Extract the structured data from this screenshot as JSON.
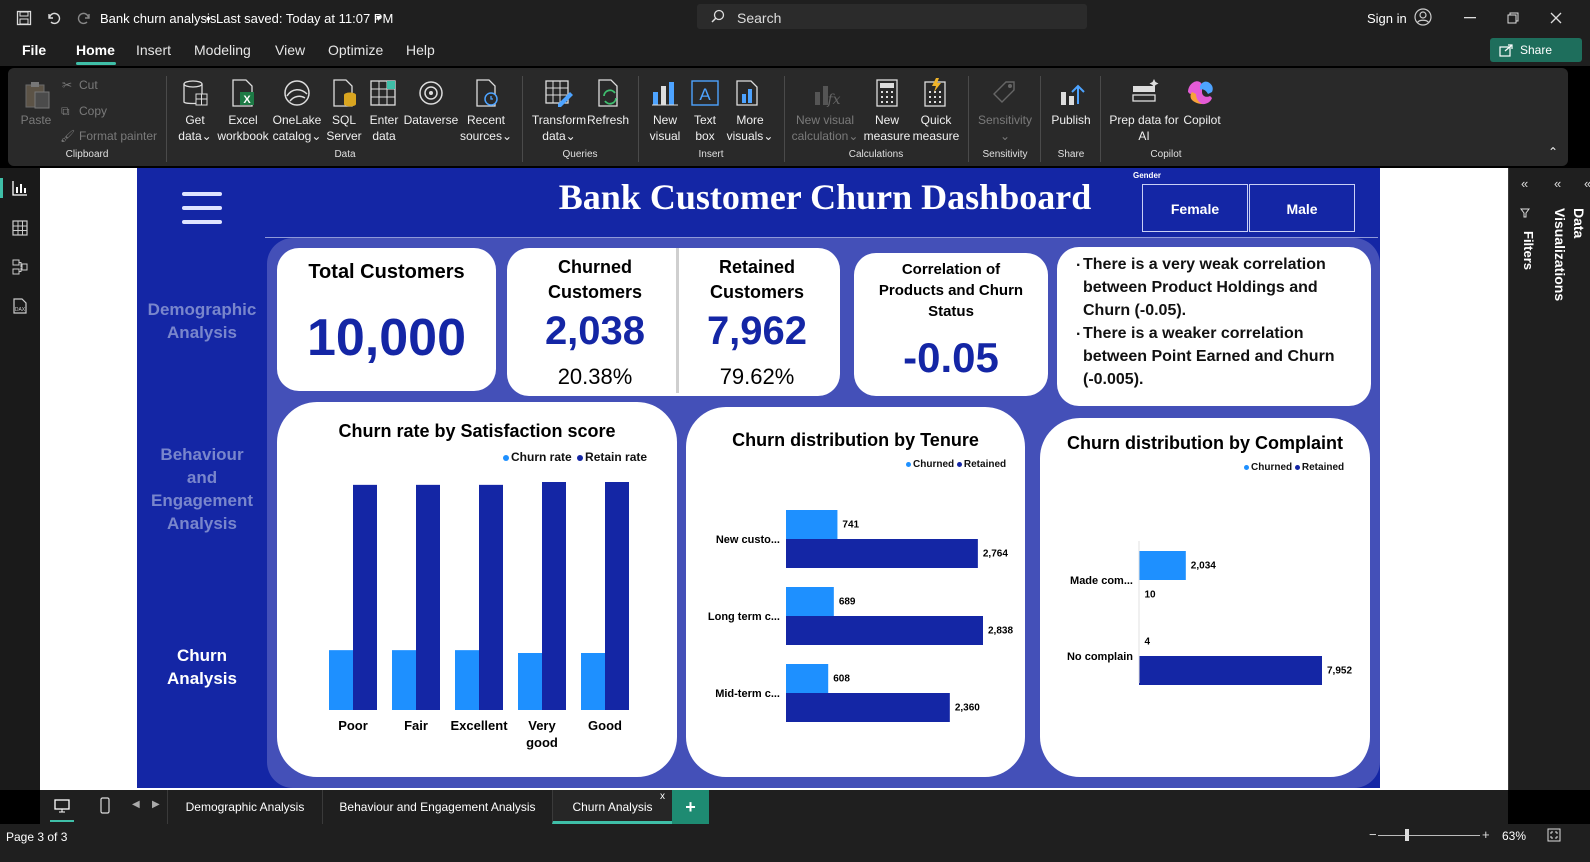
{
  "titlebar": {
    "doc_title": "Bank churn analysis",
    "saved": "Last saved: Today at 11:07 PM",
    "search_placeholder": "Search",
    "sign_in": "Sign in"
  },
  "menu": {
    "items": [
      "File",
      "Home",
      "Insert",
      "Modeling",
      "View",
      "Optimize",
      "Help"
    ],
    "active": "Home",
    "share": "Share"
  },
  "ribbon": {
    "clipboard": {
      "paste": "Paste",
      "cut": "Cut",
      "copy": "Copy",
      "format_painter": "Format painter",
      "group": "Clipboard"
    },
    "data": {
      "get_data": [
        "Get",
        "data"
      ],
      "excel": [
        "Excel",
        "workbook"
      ],
      "onelake": [
        "OneLake",
        "catalog"
      ],
      "sql": [
        "SQL",
        "Server"
      ],
      "enter": [
        "Enter",
        "data"
      ],
      "dataverse": [
        "Dataverse",
        ""
      ],
      "recent": [
        "Recent",
        "sources"
      ],
      "group": "Data"
    },
    "queries": {
      "transform": [
        "Transform",
        "data"
      ],
      "refresh": [
        "Refresh",
        ""
      ],
      "group": "Queries"
    },
    "insert": {
      "new_visual": [
        "New",
        "visual"
      ],
      "text_box": [
        "Text",
        "box"
      ],
      "more_visuals": [
        "More",
        "visuals"
      ],
      "group": "Insert"
    },
    "calculations": {
      "new_visual_calc": [
        "New visual",
        "calculation"
      ],
      "new_measure": [
        "New",
        "measure"
      ],
      "quick_measure": [
        "Quick",
        "measure"
      ],
      "group": "Calculations"
    },
    "sensitivity": {
      "label": "Sensitivity",
      "group": "Sensitivity"
    },
    "share": {
      "publish": "Publish",
      "group": "Share"
    },
    "copilot": {
      "prep": [
        "Prep data for",
        "AI"
      ],
      "copilot": "Copilot",
      "group": "Copilot"
    }
  },
  "colors": {
    "report_bg": "#1426a5",
    "panel_bg": "#4450b8",
    "churned": "#1e90ff",
    "retained": "#1426a5",
    "accent": "#3fbfa8"
  },
  "dashboard": {
    "title": "Bank Customer Churn Dashboard",
    "slicer": {
      "title": "Gender",
      "options": [
        "Female",
        "Male"
      ]
    },
    "nav": {
      "demographic": [
        "Demographic",
        "Analysis"
      ],
      "behaviour": [
        "Behaviour",
        "and",
        "Engagement",
        "Analysis"
      ],
      "churn": [
        "Churn",
        "Analysis"
      ]
    },
    "kpi": {
      "total_label": "Total Customers",
      "total_value": "10,000",
      "churned_label": [
        "Churned",
        "Customers"
      ],
      "churned_value": "2,038",
      "churned_pct": "20.38%",
      "retained_label": [
        "Retained",
        "Customers"
      ],
      "retained_value": "7,962",
      "retained_pct": "79.62%",
      "corr_label": [
        "Correlation of",
        "Products and Churn",
        "Status"
      ],
      "corr_value": "-0.05"
    },
    "insights": [
      "There is a very weak correlation between Product Holdings and Churn (-0.05).",
      "There is a weaker correlation between Point Earned and Churn (-0.005)."
    ]
  },
  "chart_data": [
    {
      "type": "bar",
      "title": "Churn rate by Satisfaction score",
      "categories": [
        "Poor",
        "Fair",
        "Excellent",
        "Very good",
        "Good"
      ],
      "series": [
        {
          "name": "Churn rate",
          "values": [
            0.21,
            0.21,
            0.21,
            0.2,
            0.2
          ]
        },
        {
          "name": "Retain rate",
          "values": [
            0.79,
            0.79,
            0.79,
            0.8,
            0.8
          ]
        }
      ],
      "ylim": [
        0,
        0.8
      ]
    },
    {
      "type": "bar",
      "title": "Churn distribution by Tenure",
      "orientation": "horizontal",
      "categories": [
        "New custo...",
        "Long term c...",
        "Mid-term c..."
      ],
      "series": [
        {
          "name": "Churned",
          "values": [
            741,
            689,
            608
          ]
        },
        {
          "name": "Retained",
          "values": [
            2764,
            2838,
            2360
          ]
        }
      ]
    },
    {
      "type": "bar",
      "title": "Churn distribution by Complaint",
      "orientation": "horizontal",
      "categories": [
        "Made com...",
        "No complain"
      ],
      "series": [
        {
          "name": "Churned",
          "values": [
            2034,
            4
          ]
        },
        {
          "name": "Retained",
          "values": [
            10,
            7952
          ]
        }
      ]
    }
  ],
  "pages": {
    "tabs": [
      "Demographic Analysis",
      "Behaviour and Engagement Analysis",
      "Churn Analysis"
    ],
    "active": "Churn Analysis",
    "add": "+"
  },
  "status": {
    "page": "Page 3 of 3",
    "zoom": "63%",
    "zoom_level": 0.63
  },
  "side_panes": {
    "filters": "Filters",
    "visualizations": "Visualizations",
    "data": "Data"
  }
}
